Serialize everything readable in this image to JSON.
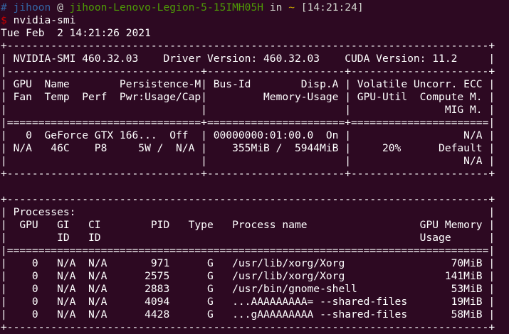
{
  "colors": {
    "background": "#2d0922",
    "text": "#ffffff",
    "prompt_hash": "#3465a4",
    "prompt_user": "#3465a4",
    "prompt_host": "#4e9a06",
    "prompt_path": "#c4a000",
    "prompt_dollar": "#cc0000"
  },
  "prompt": {
    "hash": "#",
    "user": "jihoon",
    "at": " @ ",
    "host": "jihoon-Lenovo-Legion-5-15IMH05H",
    "in": " in ",
    "path": "~",
    "time": "[14:21:24]",
    "dollar": "$",
    "command": "nvidia-smi"
  },
  "output_lines": [
    "Tue Feb  2 14:21:26 2021",
    "+-----------------------------------------------------------------------------+",
    "| NVIDIA-SMI 460.32.03    Driver Version: 460.32.03    CUDA Version: 11.2     |",
    "|-------------------------------+----------------------+----------------------+",
    "| GPU  Name        Persistence-M| Bus-Id        Disp.A | Volatile Uncorr. ECC |",
    "| Fan  Temp  Perf  Pwr:Usage/Cap|         Memory-Usage | GPU-Util  Compute M. |",
    "|                               |                      |               MIG M. |",
    "|===============================+======================+======================|",
    "|   0  GeForce GTX 166...  Off  | 00000000:01:00.0  On |                  N/A |",
    "| N/A   46C    P8     5W /  N/A |    355MiB /  5944MiB |     20%      Default |",
    "|                               |                      |                  N/A |",
    "+-------------------------------+----------------------+----------------------+",
    "",
    "+-----------------------------------------------------------------------------+",
    "| Processes:                                                                  |",
    "|  GPU   GI   CI        PID   Type   Process name                  GPU Memory |",
    "|        ID   ID                                                   Usage      |",
    "|=============================================================================|",
    "|    0   N/A  N/A       971      G   /usr/lib/xorg/Xorg                 70MiB |",
    "|    0   N/A  N/A      2575      G   /usr/lib/xorg/Xorg                141MiB |",
    "|    0   N/A  N/A      2883      G   /usr/bin/gnome-shell               53MiB |",
    "|    0   N/A  N/A      4094      G   ...AAAAAAAAA= --shared-files       19MiB |",
    "|    0   N/A  N/A      4428      G   ...gAAAAAAAAA --shared-files       58MiB |",
    "+-----------------------------------------------------------------------------+"
  ]
}
